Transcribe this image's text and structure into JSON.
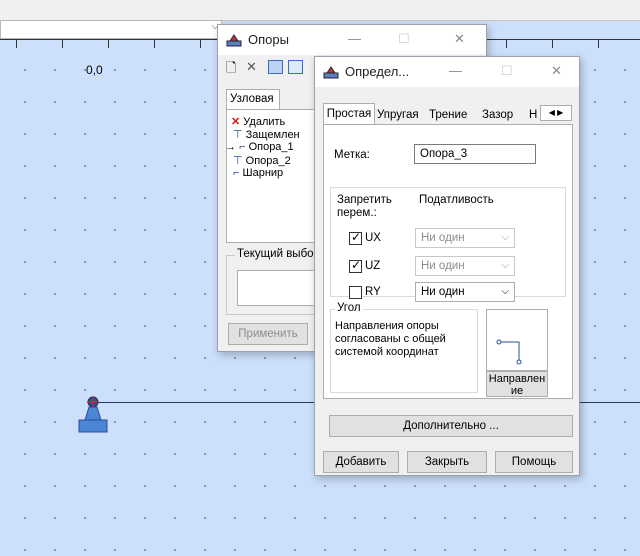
{
  "canvas": {
    "ruler_value": "0,0"
  },
  "supports_window": {
    "title": "Опоры",
    "tab_nodal": "Узловая",
    "list": [
      {
        "icon": "✕",
        "label": "Удалить"
      },
      {
        "icon": "⊤",
        "label": "Защемлен"
      },
      {
        "icon": "→",
        "label": "Опора_1"
      },
      {
        "icon": "⊤",
        "label": "Опора_2"
      },
      {
        "icon": "⌐",
        "label": "Шарнир"
      }
    ],
    "current_selection_label": "Текущий выбор",
    "apply_button": "Применить"
  },
  "define_dialog": {
    "title": "Определ...",
    "tabs": [
      "Простая",
      "Упругая",
      "Трение",
      "Зазор",
      "Н"
    ],
    "label_field": "Метка:",
    "label_value": "Опора_3",
    "restrict_label": "Запретить перем.:",
    "compliance_label": "Податливость",
    "dofs": [
      {
        "name": "UX",
        "checked": true,
        "value": "Ни один"
      },
      {
        "name": "UZ",
        "checked": true,
        "value": "Ни один"
      },
      {
        "name": "RY",
        "checked": false,
        "value": "Ни один"
      }
    ],
    "angle_group": "Угол",
    "angle_text": "Направления опоры согласованы с общей системой координат",
    "direction_button": "Направлен ие",
    "more_button": "Дополнительно ...",
    "add_button": "Добавить",
    "close_button": "Закрыть",
    "help_button": "Помощь"
  }
}
